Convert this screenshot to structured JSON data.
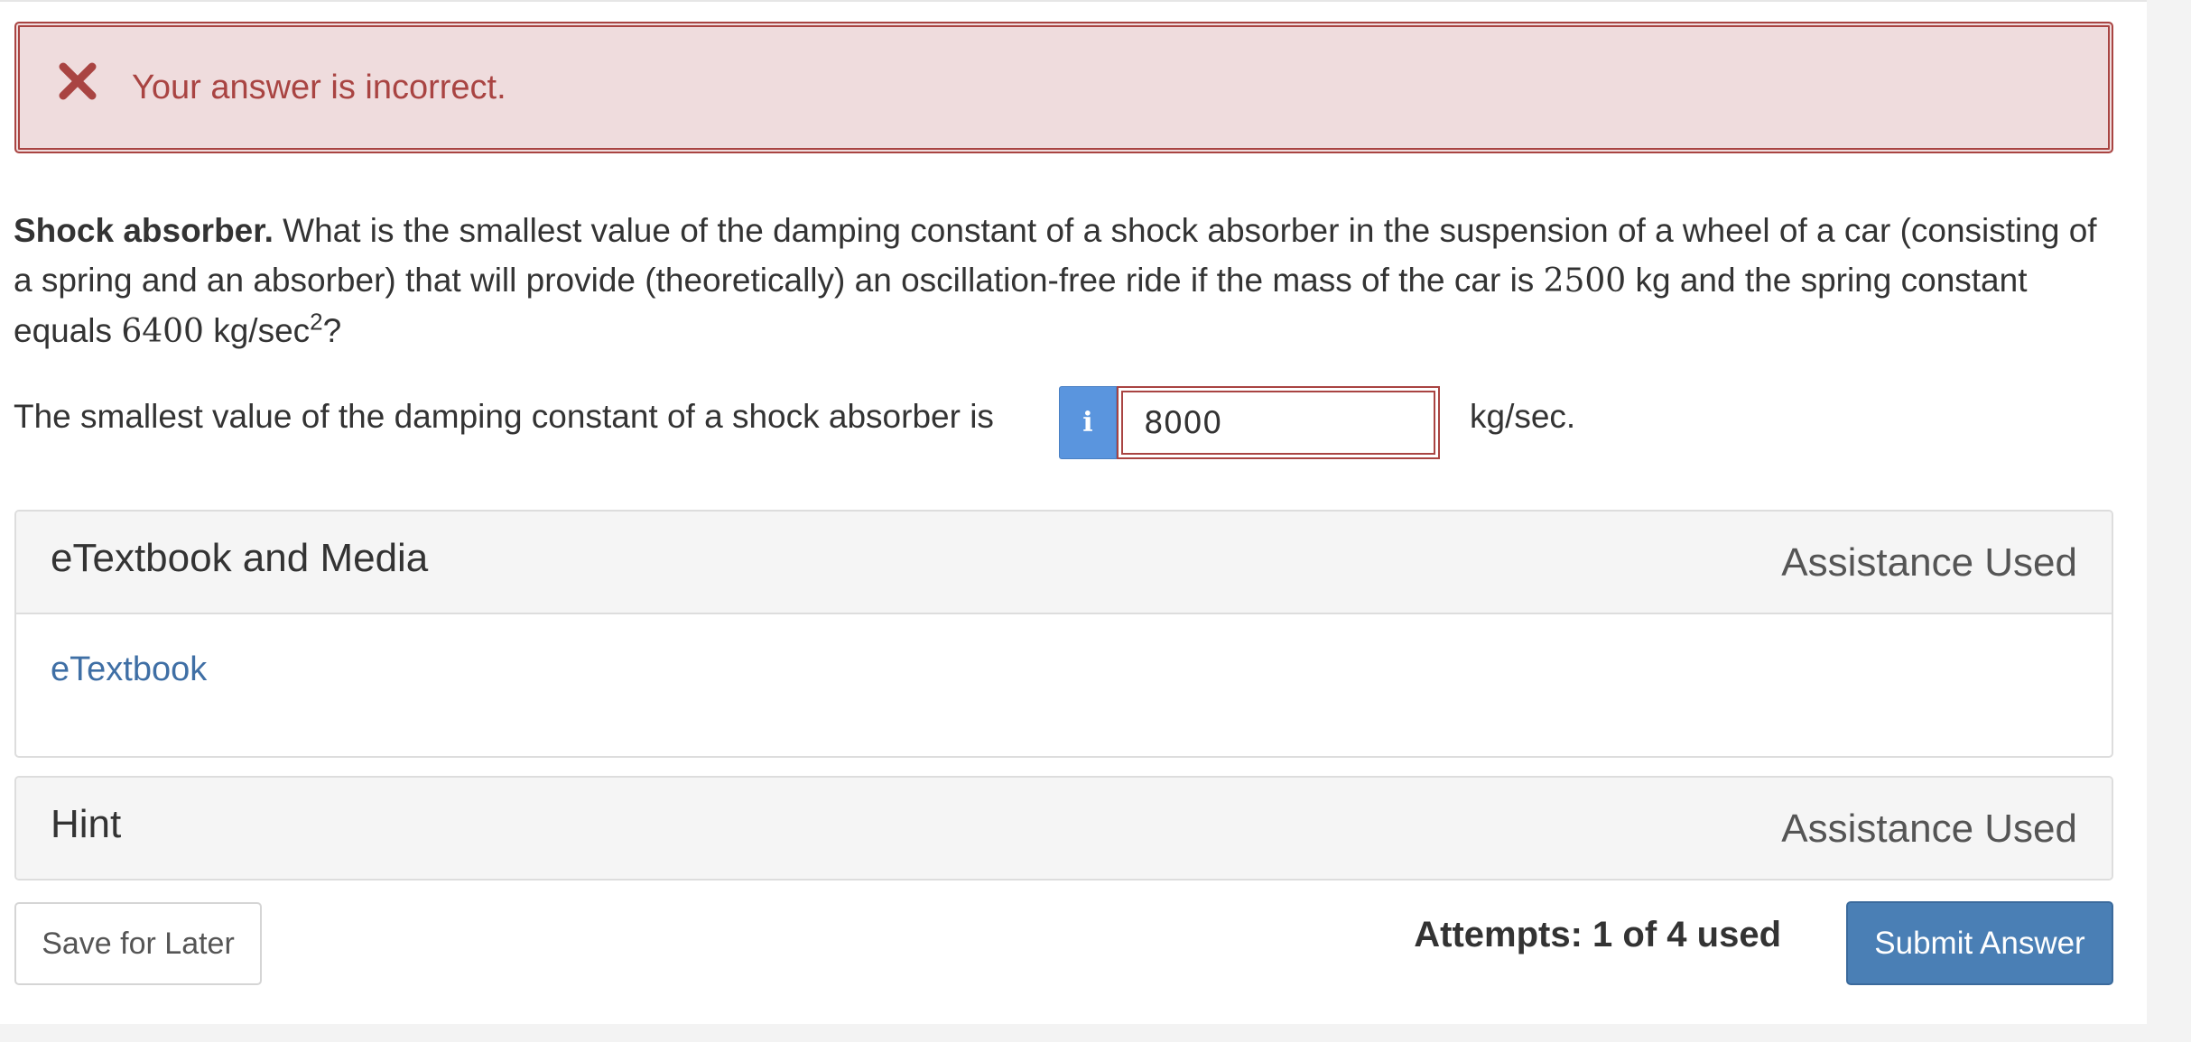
{
  "alert": {
    "icon": "close-icon",
    "message": "Your answer is incorrect.",
    "color": "#a94442",
    "background": "#efdcdd"
  },
  "question": {
    "title": "Shock absorber.",
    "text_part1": " What is the smallest value of the damping constant of a shock absorber in the suspension of a wheel of a car (consisting of a spring and an absorber) that will provide (theoretically) an oscillation-free ride if the mass of the car is ",
    "mass_value": "2500",
    "text_part2": " kg and the spring constant equals ",
    "spring_value": "6400",
    "text_part3": " kg/sec",
    "exponent": "2",
    "text_part4": "?"
  },
  "answer": {
    "prompt": "The smallest value of the damping constant of a shock absorber is",
    "info_icon": "info-icon",
    "info_glyph": "i",
    "value": "8000",
    "unit": "kg/sec."
  },
  "panels": {
    "media": {
      "title": "eTextbook and Media",
      "status": "Assistance Used",
      "link": "eTextbook"
    },
    "hint": {
      "title": "Hint",
      "status": "Assistance Used"
    }
  },
  "footer": {
    "save_label": "Save for Later",
    "attempts": "Attempts: 1 of 4 used",
    "submit_label": "Submit Answer",
    "submit_color": "#4a7fb5"
  }
}
